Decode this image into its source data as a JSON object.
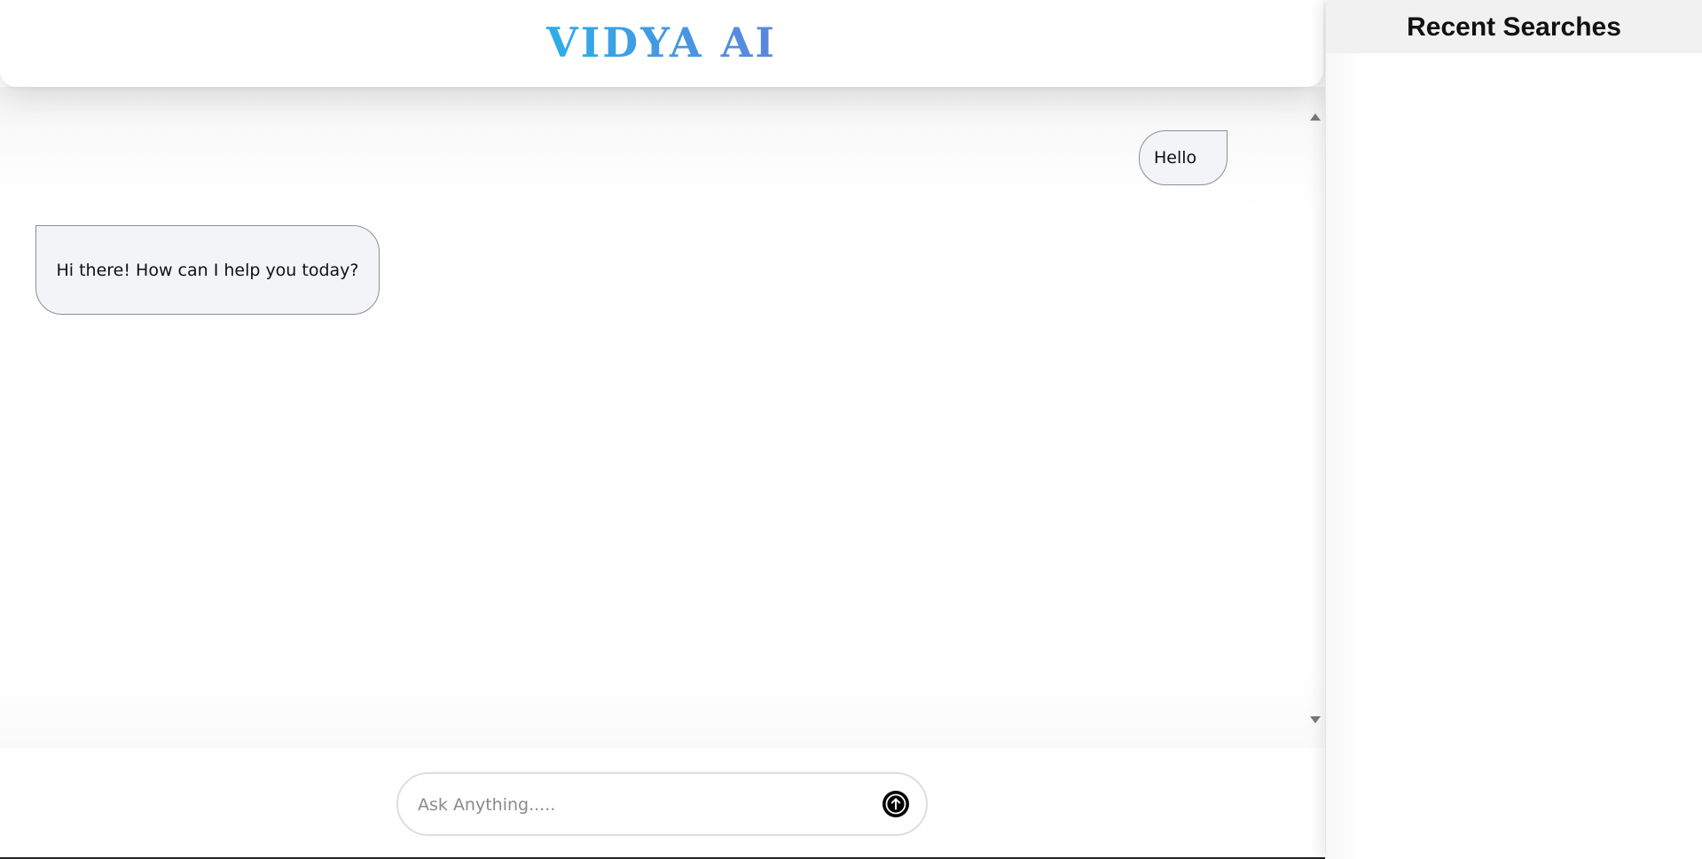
{
  "header": {
    "brand": "VIDYA AI"
  },
  "chat": {
    "messages": [
      {
        "role": "user",
        "text": "Hello"
      },
      {
        "role": "assistant",
        "text": "Hi there! How can I help you today?"
      }
    ]
  },
  "composer": {
    "placeholder": "Ask Anything.....",
    "value": "",
    "send_icon": "arrow-up-circle-icon"
  },
  "sidebar": {
    "title": "Recent Searches",
    "items": []
  },
  "colors": {
    "brand_gradient": [
      "#0d7cf2",
      "#2ab0ea",
      "#6b78d6",
      "#c23bb8",
      "#e02a9c"
    ],
    "bubble_bg": "#f2f4f7",
    "send_button": "#000000"
  }
}
